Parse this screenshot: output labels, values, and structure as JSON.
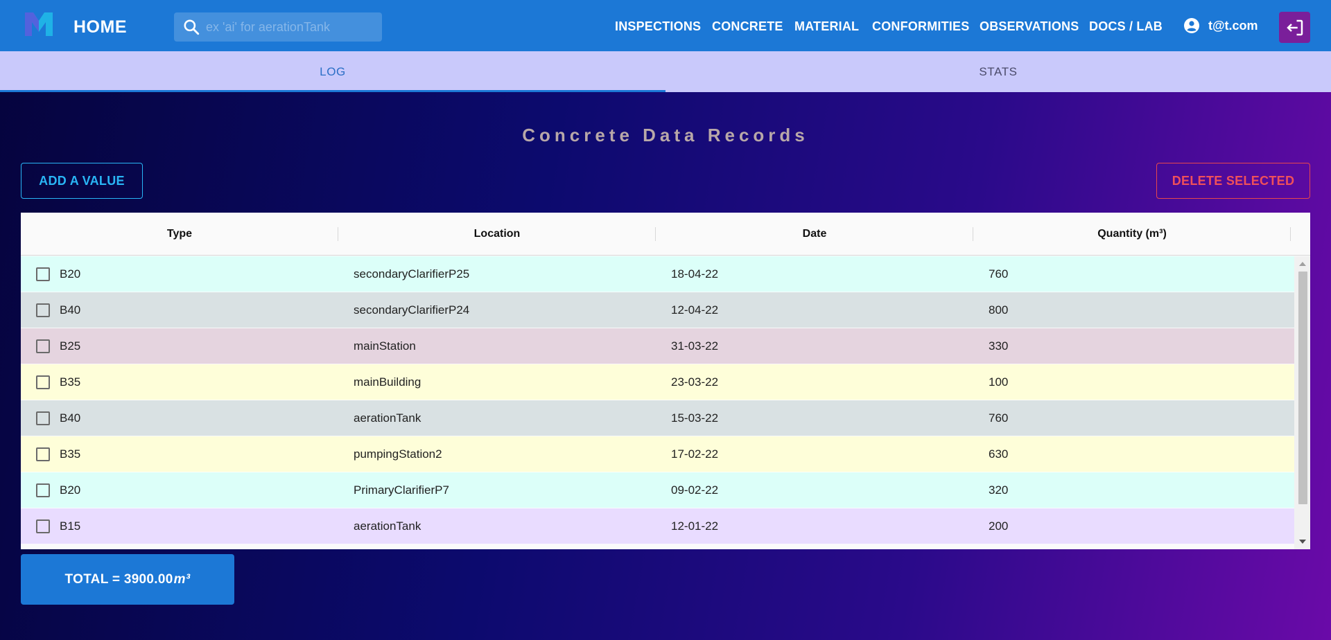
{
  "header": {
    "title": "HOME",
    "search_placeholder": "ex 'ai' for aerationTank",
    "nav": [
      "INSPECTIONS",
      "CONCRETE",
      "MATERIAL",
      "CONFORMITIES",
      "OBSERVATIONS",
      "DOCS / LAB"
    ],
    "user_email": "t@t.com"
  },
  "tabs": [
    {
      "label": "LOG",
      "active": true
    },
    {
      "label": "STATS",
      "active": false
    }
  ],
  "page_title": "Concrete Data Records",
  "buttons": {
    "add": "ADD A VALUE",
    "delete": "DELETE SELECTED"
  },
  "table": {
    "headers": [
      "Type",
      "Location",
      "Date",
      "Quantity (m³)"
    ],
    "rows": [
      {
        "type": "B20",
        "location": "secondaryClarifierP25",
        "date": "18-04-22",
        "quantity": "760",
        "color": "#dcfff9"
      },
      {
        "type": "B40",
        "location": "secondaryClarifierP24",
        "date": "12-04-22",
        "quantity": "800",
        "color": "#d9e1e3"
      },
      {
        "type": "B25",
        "location": "mainStation",
        "date": "31-03-22",
        "quantity": "330",
        "color": "#e5d4df"
      },
      {
        "type": "B35",
        "location": "mainBuilding",
        "date": "23-03-22",
        "quantity": "100",
        "color": "#fefed9"
      },
      {
        "type": "B40",
        "location": "aerationTank",
        "date": "15-03-22",
        "quantity": "760",
        "color": "#d9e1e3"
      },
      {
        "type": "B35",
        "location": "pumpingStation2",
        "date": "17-02-22",
        "quantity": "630",
        "color": "#fefed9"
      },
      {
        "type": "B20",
        "location": "PrimaryClarifierP7",
        "date": "09-02-22",
        "quantity": "320",
        "color": "#dcfff9"
      },
      {
        "type": "B15",
        "location": "aerationTank",
        "date": "12-01-22",
        "quantity": "200",
        "color": "#e9dcff"
      }
    ]
  },
  "total": {
    "label": "TOTAL = 3900.00",
    "unit": "m³"
  },
  "colors": {
    "appbar": "#1c78d6",
    "tabs_bg": "#c9c9fb",
    "add_button": "#29b6f6",
    "delete_button": "#f0505a",
    "logout_bg": "#7a1f9a"
  },
  "icons": {
    "logo": "app-logo-icon",
    "search": "search-icon",
    "account": "account-circle-icon",
    "logout": "logout-icon",
    "checkbox": "checkbox-icon",
    "scroll_up": "scroll-up-arrow-icon",
    "scroll_down": "scroll-down-arrow-icon"
  }
}
